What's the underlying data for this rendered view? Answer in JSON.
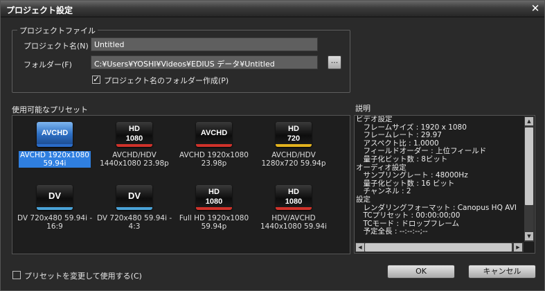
{
  "window": {
    "title": "プロジェクト設定"
  },
  "project_file": {
    "legend": "プロジェクトファイル",
    "name_label": "プロジェクト名(N)",
    "name_value": "Untitled",
    "folder_label": "フォルダー(F)",
    "folder_value": "C:¥Users¥YOSHI¥Videos¥EDIUS データ¥Untitled",
    "browse_label": "...",
    "create_folder_label": "プロジェクト名のフォルダー作成(P)",
    "create_folder_checked": true
  },
  "presets": {
    "label": "使用可能なプリセット",
    "items": [
      {
        "icon": "avchd-icon",
        "icon_text": "AVCHD",
        "name1": "AVCHD 1920x1080",
        "name2": "59.94i",
        "selected": true
      },
      {
        "icon": "hd1080-icon",
        "icon_text1": "HD",
        "icon_text2": "1080",
        "name1": "AVCHD/HDV",
        "name2": "1440x1080 23.98p"
      },
      {
        "icon": "avchd-icon",
        "icon_text": "AVCHD",
        "name1": "AVCHD 1920x1080",
        "name2": "23.98p"
      },
      {
        "icon": "hd720-icon",
        "icon_text1": "HD",
        "icon_text2": "720",
        "name1": "AVCHD/HDV",
        "name2": "1280x720 59.94p"
      },
      {
        "icon": "dv-icon",
        "icon_text": "DV",
        "name1": "DV 720x480 59.94i -",
        "name2": "16:9"
      },
      {
        "icon": "dv-icon",
        "icon_text": "DV",
        "name1": "DV 720x480 59.94i -",
        "name2": "4:3"
      },
      {
        "icon": "hd1080-icon",
        "icon_text1": "HD",
        "icon_text2": "1080",
        "name1": "Full HD 1920x1080",
        "name2": "59.94p"
      },
      {
        "icon": "hd1080-icon",
        "icon_text1": "HD",
        "icon_text2": "1080",
        "name1": "HDV/AVCHD",
        "name2": "1440x1080 59.94i"
      }
    ]
  },
  "description": {
    "label": "説明",
    "lines": [
      "ビデオ設定",
      "　フレームサイズ : 1920 x 1080",
      "　フレームレート : 29.97",
      "　アスペクト比 : 1.0000",
      "　フィールドオーダー : 上位フィールド",
      "　量子化ビット数 : 8ビット",
      "オーディオ設定",
      "　サンプリングレート : 48000Hz",
      "　量子化ビット数 : 16 ビット",
      "　チャンネル : 2",
      "設定",
      "　レンダリングフォーマット : Canopus HQ AVI",
      "　TCプリセット : 00:00:00;00",
      "　TCモード : ドロップフレーム",
      "　予定全長 : --:--:--;--"
    ]
  },
  "footer": {
    "modify_preset_label": "プリセットを変更して使用する(C)",
    "modify_preset_checked": false,
    "ok_label": "OK",
    "cancel_label": "キャンセル"
  }
}
